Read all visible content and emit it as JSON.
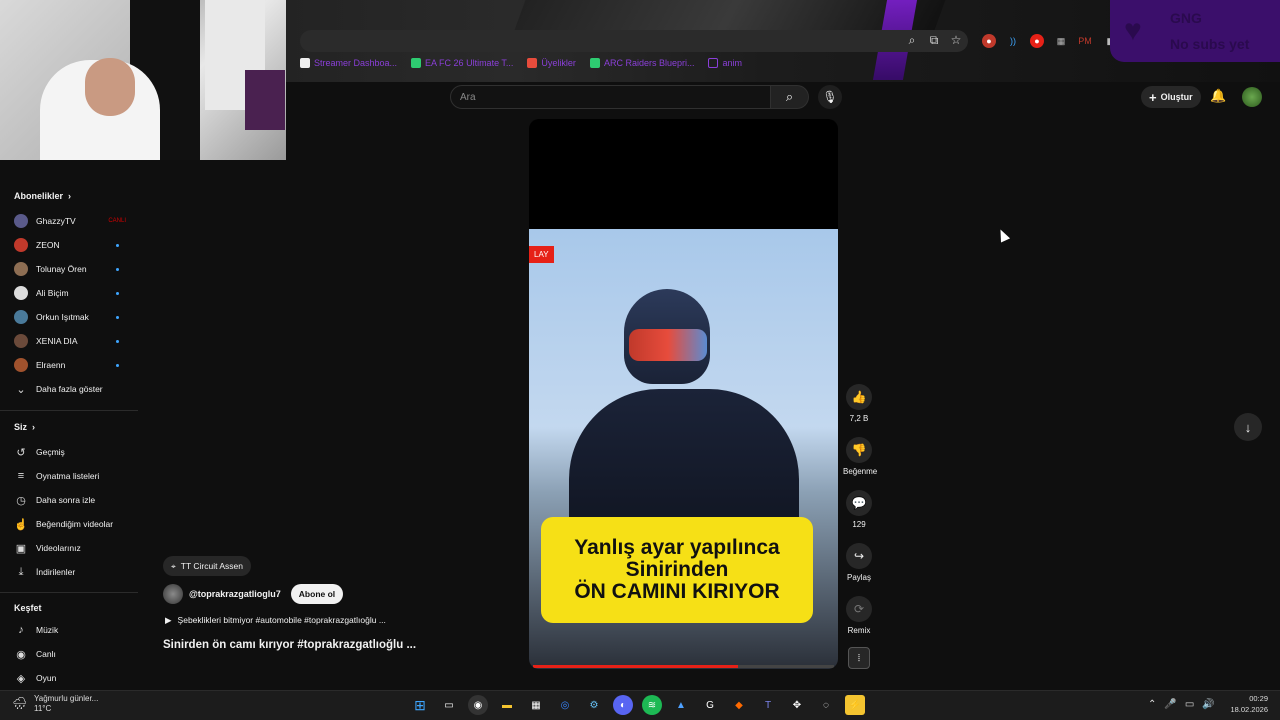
{
  "browser": {
    "bookmarks": [
      {
        "label": "Streamer Dashboa...",
        "color": "#ffffff"
      },
      {
        "label": "EA FC 26 Ultimate T...",
        "color": "#2ecc71"
      },
      {
        "label": "Üyelikler",
        "color": "#e74c3c"
      },
      {
        "label": "ARC Raiders Bluepri...",
        "color": "#2ecc71"
      },
      {
        "label": "anim",
        "color": "#8a3fd8"
      }
    ]
  },
  "overlay": {
    "line1": "GNG",
    "line2": "No subs yet"
  },
  "header": {
    "search_placeholder": "Ara",
    "create_label": "Oluştur"
  },
  "sidebar": {
    "subscriptions_heading": "Abonelikler",
    "subscriptions": [
      {
        "name": "GhazzyTV",
        "color": "#5a5a8a",
        "live": "CANLI"
      },
      {
        "name": "ZEON",
        "color": "#c0392b"
      },
      {
        "name": "Tolunay Ören",
        "color": "#8e6e53"
      },
      {
        "name": "Ali Biçim",
        "color": "#dcdcdc"
      },
      {
        "name": "Orkun Işıtmak",
        "color": "#4a7a9a"
      },
      {
        "name": "XENIA DIA",
        "color": "#6b4a3a"
      },
      {
        "name": "Elraenn",
        "color": "#a0522d"
      }
    ],
    "show_more": "Daha fazla göster",
    "you_heading": "Siz",
    "you_items": [
      {
        "label": "Geçmiş",
        "icon": "history-icon",
        "glyph": "↺"
      },
      {
        "label": "Oynatma listeleri",
        "icon": "playlist-icon",
        "glyph": "≡"
      },
      {
        "label": "Daha sonra izle",
        "icon": "clock-icon",
        "glyph": "◷"
      },
      {
        "label": "Beğendiğim videolar",
        "icon": "thumbs-up-icon",
        "glyph": "👍"
      },
      {
        "label": "Videolarınız",
        "icon": "video-icon",
        "glyph": "▶"
      },
      {
        "label": "İndirilenler",
        "icon": "download-icon",
        "glyph": "⤓"
      }
    ],
    "explore_heading": "Keşfet",
    "explore_items": [
      {
        "label": "Müzik",
        "icon": "music-icon",
        "glyph": "♪"
      },
      {
        "label": "Canlı",
        "icon": "live-icon",
        "glyph": "◉"
      },
      {
        "label": "Oyun",
        "icon": "gamepad-icon",
        "glyph": "◈"
      }
    ]
  },
  "video": {
    "replay_badge": "LAY",
    "caption_line1": "Yanlış ayar yapılınca",
    "caption_line2": "Sinirinden",
    "caption_line3": "ÖN CAMINI KIRIYOR",
    "progress": 0.68
  },
  "actions": {
    "likes": "7,2 B",
    "dislike_label": "Beğenme",
    "comments": "129",
    "share_label": "Paylaş",
    "remix_label": "Remix"
  },
  "info": {
    "location": "TT Circuit Assen",
    "channel": "@toprakrazgatlioglu7",
    "subscribe_label": "Abone ol",
    "description": "Şebeklikleri bitmiyor #automobile #toprakrazgatlıoğlu ...",
    "title": "Sinirden ön camı kırıyor #toprakrazgatlıoğlu ..."
  },
  "taskbar": {
    "weather_text": "Yağmurlu günler...",
    "temperature": "11°C",
    "time": "00:29",
    "date": "18.02.2026"
  }
}
